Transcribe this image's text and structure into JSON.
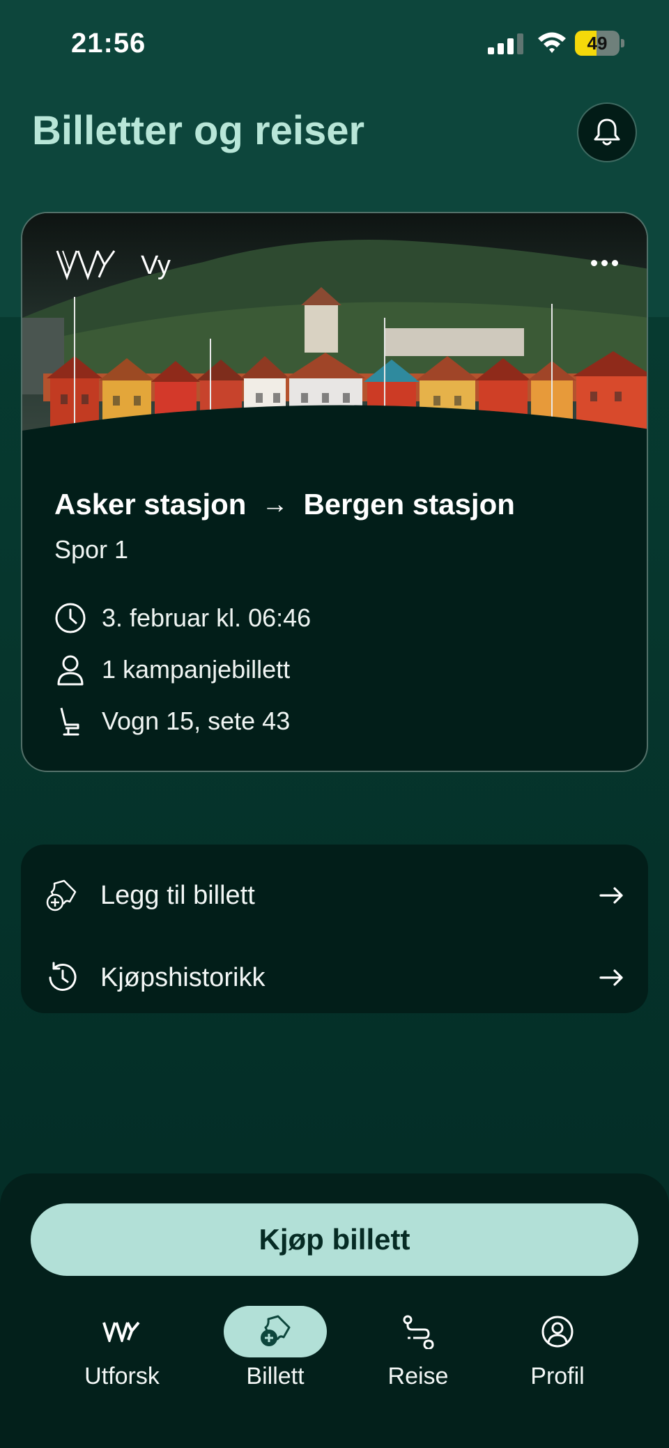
{
  "status_bar": {
    "time": "21:56",
    "battery_level": "49",
    "battery_fraction": 0.49,
    "icons": [
      "cellular-signal-icon",
      "wifi-icon",
      "battery-icon"
    ]
  },
  "header": {
    "title": "Billetter og reiser",
    "notification_icon": "bell-icon"
  },
  "ticket": {
    "operator": "Vy",
    "logo": "vy-logo",
    "more_icon": "more-dots-icon",
    "from": "Asker stasjon",
    "arrow": "→",
    "to": "Bergen stasjon",
    "platform": "Spor 1",
    "departure": "3. februar kl. 06:46",
    "tickets": "1 kampanjebillett",
    "seat": "Vogn 15, sete 43",
    "icons": [
      "clock-icon",
      "person-icon",
      "seat-icon"
    ]
  },
  "actions": [
    {
      "label": "Legg til billett",
      "icon": "add-ticket-icon"
    },
    {
      "label": "Kjøpshistorikk",
      "icon": "history-icon"
    }
  ],
  "buy_button": {
    "label": "Kjøp billett"
  },
  "bottom_nav": [
    {
      "label": "Utforsk",
      "icon": "vy-logo-icon",
      "active": false
    },
    {
      "label": "Billett",
      "icon": "ticket-icon",
      "active": true
    },
    {
      "label": "Reise",
      "icon": "route-icon",
      "active": false
    },
    {
      "label": "Profil",
      "icon": "profile-icon",
      "active": false
    }
  ],
  "colors": {
    "background": "#0d463c",
    "card": "#021e19",
    "accent": "#b2e0d7",
    "title": "#b8e6d8",
    "battery": "#f5d90a"
  }
}
